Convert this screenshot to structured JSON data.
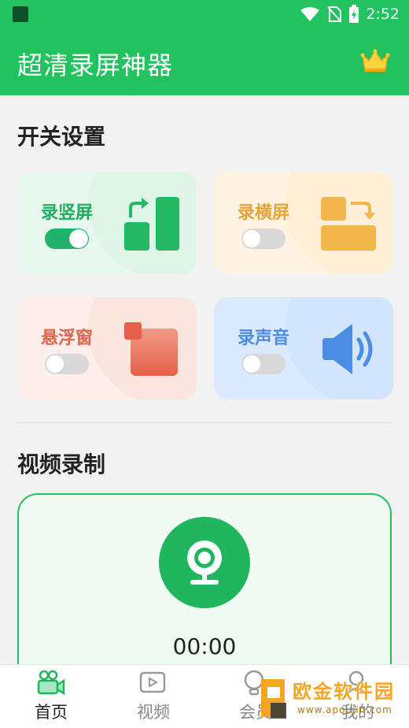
{
  "status_bar": {
    "time": "2:52"
  },
  "header": {
    "title": "超清录屏神器",
    "vip_icon": "crown-icon"
  },
  "switch_section": {
    "title": "开关设置",
    "cards": [
      {
        "label": "录竖屏",
        "enabled": true,
        "label_color": "#1fae5d",
        "icon": "portrait-screen-icon"
      },
      {
        "label": "录横屏",
        "enabled": false,
        "label_color": "#e8a33a",
        "icon": "landscape-screen-icon"
      },
      {
        "label": "悬浮窗",
        "enabled": false,
        "label_color": "#e0654d",
        "icon": "floating-window-icon"
      },
      {
        "label": "录声音",
        "enabled": false,
        "label_color": "#4a8ce6",
        "icon": "speaker-icon"
      }
    ]
  },
  "video_section": {
    "title": "视频录制",
    "timer": "00:00",
    "record_icon": "webcam-icon"
  },
  "bottom_nav": {
    "items": [
      {
        "label": "首页",
        "icon": "video-camera-icon",
        "active": true
      },
      {
        "label": "视频",
        "icon": "video-file-icon",
        "active": false
      },
      {
        "label": "会员",
        "icon": "lightbulb-icon",
        "active": false
      },
      {
        "label": "我的",
        "icon": "user-icon",
        "active": false
      }
    ]
  },
  "watermark": {
    "text": "欧金软件园",
    "url": "www.apoujin.com"
  },
  "colors": {
    "primary": "#22c25e",
    "record": "#1fb65d"
  }
}
